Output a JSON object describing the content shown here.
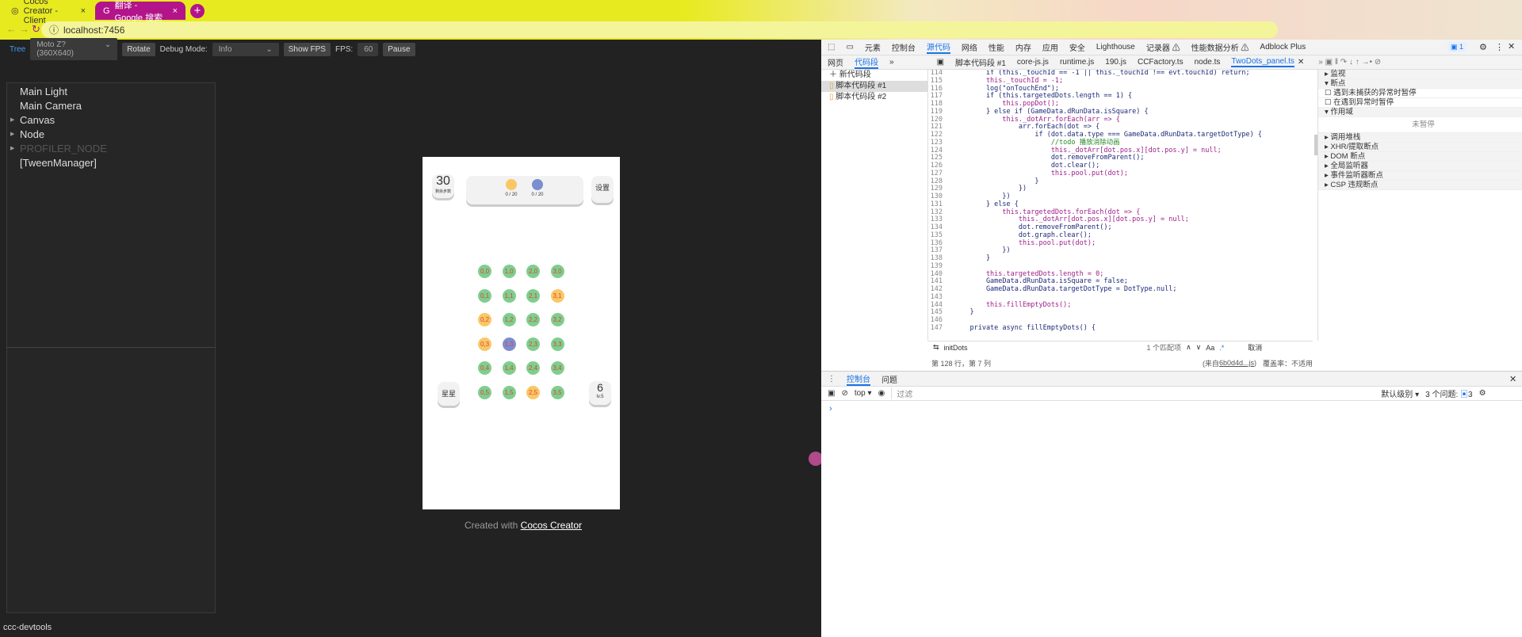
{
  "browser": {
    "tabs": [
      {
        "title": "Cocos Creator - Client"
      },
      {
        "title": "翻译 - Google 搜索"
      }
    ],
    "url": "localhost:7456"
  },
  "toolbar": {
    "tree": "Tree",
    "device": "Moto Z? (360X640)",
    "rotate": "Rotate",
    "debug_label": "Debug Mode:",
    "debug_value": "Info",
    "show_fps": "Show FPS",
    "fps_label": "FPS:",
    "fps_value": "60",
    "pause": "Pause"
  },
  "tree": {
    "items": [
      {
        "label": "Main Light",
        "arrow": false
      },
      {
        "label": "Main Camera",
        "arrow": false
      },
      {
        "label": "Canvas",
        "arrow": true
      },
      {
        "label": "Node",
        "arrow": true
      },
      {
        "label": "PROFILER_NODE",
        "arrow": true,
        "dim": true
      },
      {
        "label": "[TweenManager]",
        "arrow": false
      }
    ]
  },
  "footer_label": "ccc-devtools",
  "game": {
    "moves": "30",
    "moves_sub": "剩余步数",
    "goal1": "0 / 20",
    "goal2": "0 / 20",
    "settings": "设置",
    "stars": "星星",
    "level": "6",
    "level_sub": "lv.5",
    "colors": {
      "green": "#7ecf8e",
      "yellow": "#f9c865",
      "blue": "#7b8ed0",
      "label": "#e0403a"
    },
    "grid": [
      [
        "green",
        "green",
        "yellow",
        "yellow",
        "green",
        "green"
      ],
      [
        "green",
        "green",
        "green",
        "blue",
        "green",
        "green"
      ],
      [
        "green",
        "green",
        "green",
        "green",
        "green",
        "yellow"
      ],
      [
        "green",
        "yellow",
        "green",
        "green",
        "green",
        "green"
      ]
    ]
  },
  "created": {
    "prefix": "Created with ",
    "link": "Cocos Creator"
  },
  "devtools": {
    "main_tabs": [
      "元素",
      "控制台",
      "源代码",
      "网络",
      "性能",
      "内存",
      "应用",
      "安全",
      "Lighthouse",
      "记录器 ⚠",
      "性能数据分析 ⚠",
      "Adblock Plus"
    ],
    "active_main": "源代码",
    "issues_badge": "1",
    "nav_tabs": [
      "网页",
      "代码段"
    ],
    "file_tabs": [
      "脚本代码段 #1",
      "core-js.js",
      "runtime.js",
      "190.js",
      "CCFactory.ts",
      "node.ts",
      "TwoDots_panel.ts"
    ],
    "new_snippet": "新代码段",
    "snippets": [
      "脚本代码段 #1",
      "脚本代码段 #2"
    ],
    "code": [
      {
        "n": "114",
        "t": "        if (this._touchId == -1 || this._touchId !== evt.touchId) return;"
      },
      {
        "n": "115",
        "t": "        this._touchId = -1;"
      },
      {
        "n": "116",
        "t": "        log(\"onTouchEnd\");"
      },
      {
        "n": "117",
        "t": "        if (this.targetedDots.length == 1) {"
      },
      {
        "n": "118",
        "t": "            this.popDot();"
      },
      {
        "n": "119",
        "t": "        } else if (GameData.dRunData.isSquare) {"
      },
      {
        "n": "120",
        "t": "            this._dotArr.forEach(arr => {"
      },
      {
        "n": "121",
        "t": "                arr.forEach(dot => {"
      },
      {
        "n": "122",
        "t": "                    if (dot.data.type === GameData.dRunData.targetDotType) {"
      },
      {
        "n": "123",
        "t": "                        //todo 播放消除动画"
      },
      {
        "n": "124",
        "t": "                        this._dotArr[dot.pos.x][dot.pos.y] = null;"
      },
      {
        "n": "125",
        "t": "                        dot.removeFromParent();"
      },
      {
        "n": "126",
        "t": "                        dot.clear();"
      },
      {
        "n": "127",
        "t": "                        this.pool.put(dot);"
      },
      {
        "n": "128",
        "t": "                    }"
      },
      {
        "n": "129",
        "t": "                })"
      },
      {
        "n": "130",
        "t": "            })"
      },
      {
        "n": "131",
        "t": "        } else {"
      },
      {
        "n": "132",
        "t": "            this.targetedDots.forEach(dot => {"
      },
      {
        "n": "133",
        "t": "                this._dotArr[dot.pos.x][dot.pos.y] = null;"
      },
      {
        "n": "134",
        "t": "                dot.removeFromParent();"
      },
      {
        "n": "135",
        "t": "                dot.graph.clear();"
      },
      {
        "n": "136",
        "t": "                this.pool.put(dot);"
      },
      {
        "n": "137",
        "t": "            })"
      },
      {
        "n": "138",
        "t": "        }"
      },
      {
        "n": "139",
        "t": ""
      },
      {
        "n": "140",
        "t": "        this.targetedDots.length = 0;"
      },
      {
        "n": "141",
        "t": "        GameData.dRunData.isSquare = false;"
      },
      {
        "n": "142",
        "t": "        GameData.dRunData.targetDotType = DotType.null;"
      },
      {
        "n": "143",
        "t": ""
      },
      {
        "n": "144",
        "t": "        this.fillEmptyDots();"
      },
      {
        "n": "145",
        "t": "    }"
      },
      {
        "n": "146",
        "t": ""
      },
      {
        "n": "147",
        "t": "    private async fillEmptyDots() {"
      }
    ],
    "search": {
      "value": "initDots",
      "matches": "1 个匹配项",
      "aa": "Aa",
      "regex": ".*",
      "cancel": "取消"
    },
    "status": {
      "pos": "第 128 行，第 7 列",
      "source_prefix": "(来自 ",
      "source_link": "6b0d4d...js",
      "source_suffix": ")",
      "coverage": "覆盖率：不适用"
    },
    "right_sections": [
      {
        "label": "▸ 监视",
        "type": "h"
      },
      {
        "label": "▾ 断点",
        "type": "h"
      },
      {
        "label": "遇到未捕获的异常时暂停",
        "type": "cb"
      },
      {
        "label": "在遇到异常时暂停",
        "type": "cb"
      },
      {
        "label": "▾ 作用域",
        "type": "h"
      },
      {
        "label": "未暂停",
        "type": "c"
      },
      {
        "label": "▸ 调用堆栈",
        "type": "h"
      },
      {
        "label": "▸ XHR/提取断点",
        "type": "h"
      },
      {
        "label": "▸ DOM 断点",
        "type": "h"
      },
      {
        "label": "▸ 全局监听器",
        "type": "h"
      },
      {
        "label": "▸ 事件监听器断点",
        "type": "h"
      },
      {
        "label": "▸ CSP 违规断点",
        "type": "h"
      }
    ],
    "console_tabs": [
      "控制台",
      "问题"
    ],
    "console": {
      "context": "top",
      "filter_placeholder": "过滤",
      "levels": "默认级别",
      "issues": "3 个问题:",
      "issues_count": "3",
      "prompt": "›"
    }
  }
}
